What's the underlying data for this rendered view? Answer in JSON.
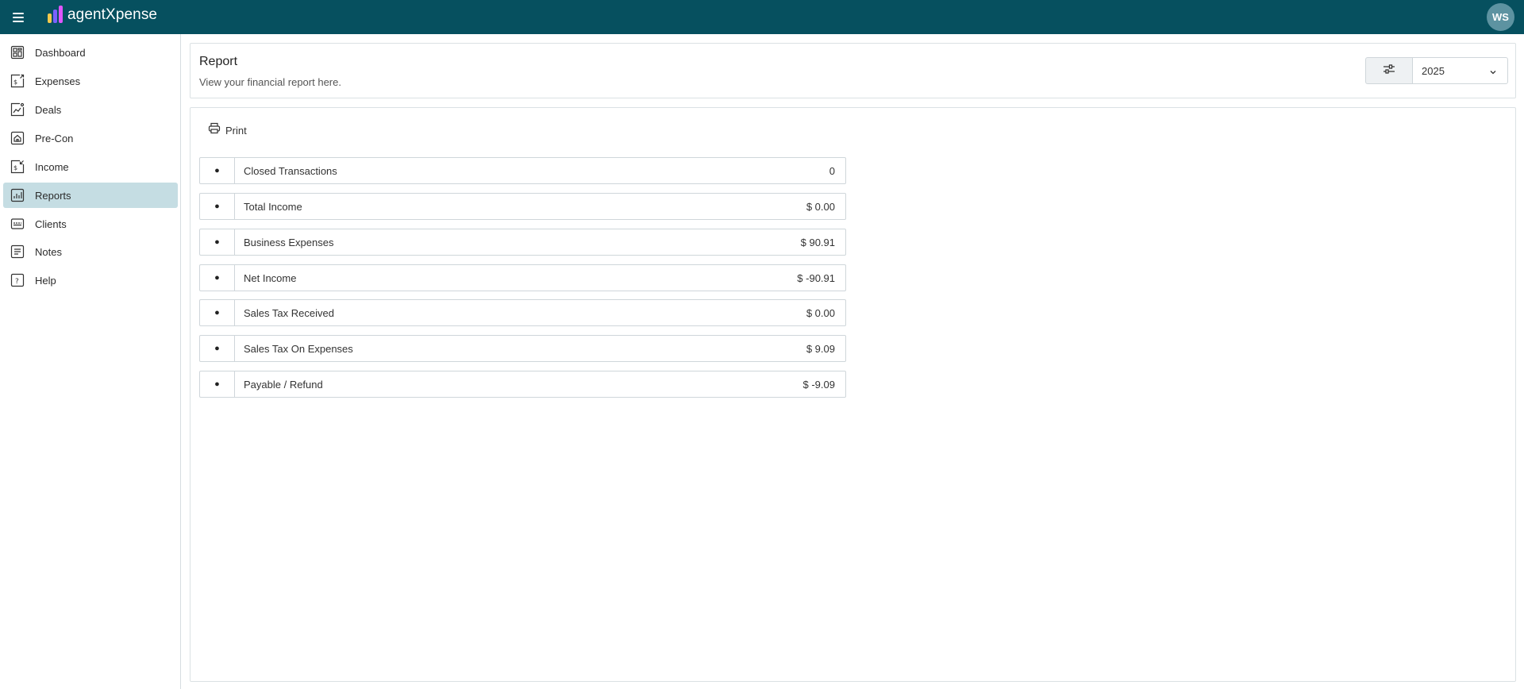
{
  "app": {
    "name": "agentXpense",
    "user_initials": "WS",
    "brand_colors": {
      "topbar": "#06505f",
      "active_nav": "#c5dde3",
      "logo_bars": [
        "#f2c94c",
        "#7b61ff",
        "#e056fd"
      ]
    }
  },
  "sidebar": {
    "items": [
      {
        "label": "Dashboard",
        "icon": "dashboard-icon",
        "active": false
      },
      {
        "label": "Expenses",
        "icon": "expenses-dollar-icon",
        "active": false
      },
      {
        "label": "Deals",
        "icon": "deals-chart-icon",
        "active": false
      },
      {
        "label": "Pre-Con",
        "icon": "pre-con-house-icon",
        "active": false
      },
      {
        "label": "Income",
        "icon": "income-dollar-icon",
        "active": false
      },
      {
        "label": "Reports",
        "icon": "reports-bar-chart-icon",
        "active": true
      },
      {
        "label": "Clients",
        "icon": "clients-card-icon",
        "active": false
      },
      {
        "label": "Notes",
        "icon": "notes-icon",
        "active": false
      },
      {
        "label": "Help",
        "icon": "help-icon",
        "active": false
      }
    ]
  },
  "header": {
    "title": "Report",
    "subtitle": "View your financial report here.",
    "year_selected": "2025",
    "filter_icon": "sliders-icon"
  },
  "report": {
    "print_label": "Print",
    "bullet": "●",
    "rows": [
      {
        "label": "Closed Transactions",
        "value": "0"
      },
      {
        "label": "Total Income",
        "value": "$ 0.00"
      },
      {
        "label": "Business Expenses",
        "value": "$ 90.91"
      },
      {
        "label": "Net Income",
        "value": "$ -90.91"
      },
      {
        "label": "Sales Tax Received",
        "value": "$ 0.00"
      },
      {
        "label": "Sales Tax On Expenses",
        "value": "$ 9.09"
      },
      {
        "label": "Payable / Refund",
        "value": "$ -9.09"
      }
    ]
  }
}
